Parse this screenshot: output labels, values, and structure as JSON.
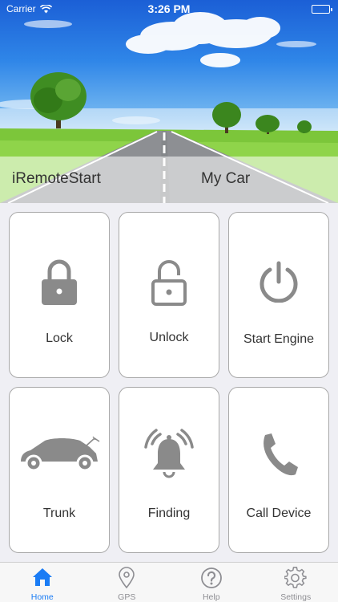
{
  "status_bar": {
    "carrier": "Carrier",
    "time": "3:26 PM"
  },
  "header": {
    "app_name": "iRemoteStart",
    "car_name": "My Car"
  },
  "tiles": [
    {
      "label": "Lock",
      "icon": "lock-icon"
    },
    {
      "label": "Unlock",
      "icon": "unlock-icon"
    },
    {
      "label": "Start Engine",
      "icon": "power-icon"
    },
    {
      "label": "Trunk",
      "icon": "car-trunk-icon"
    },
    {
      "label": "Finding",
      "icon": "alarm-bell-icon"
    },
    {
      "label": "Call Device",
      "icon": "phone-icon"
    }
  ],
  "tabbar": {
    "active": "Home",
    "tabs": [
      {
        "label": "Home",
        "icon": "home-icon"
      },
      {
        "label": "GPS",
        "icon": "location-pin-icon"
      },
      {
        "label": "Help",
        "icon": "help-icon"
      },
      {
        "label": "Settings",
        "icon": "gear-icon"
      }
    ]
  },
  "colors": {
    "accent": "#1a7cf5",
    "icon_gray": "#8a8a8a",
    "tab_inactive": "#8e8e93"
  }
}
